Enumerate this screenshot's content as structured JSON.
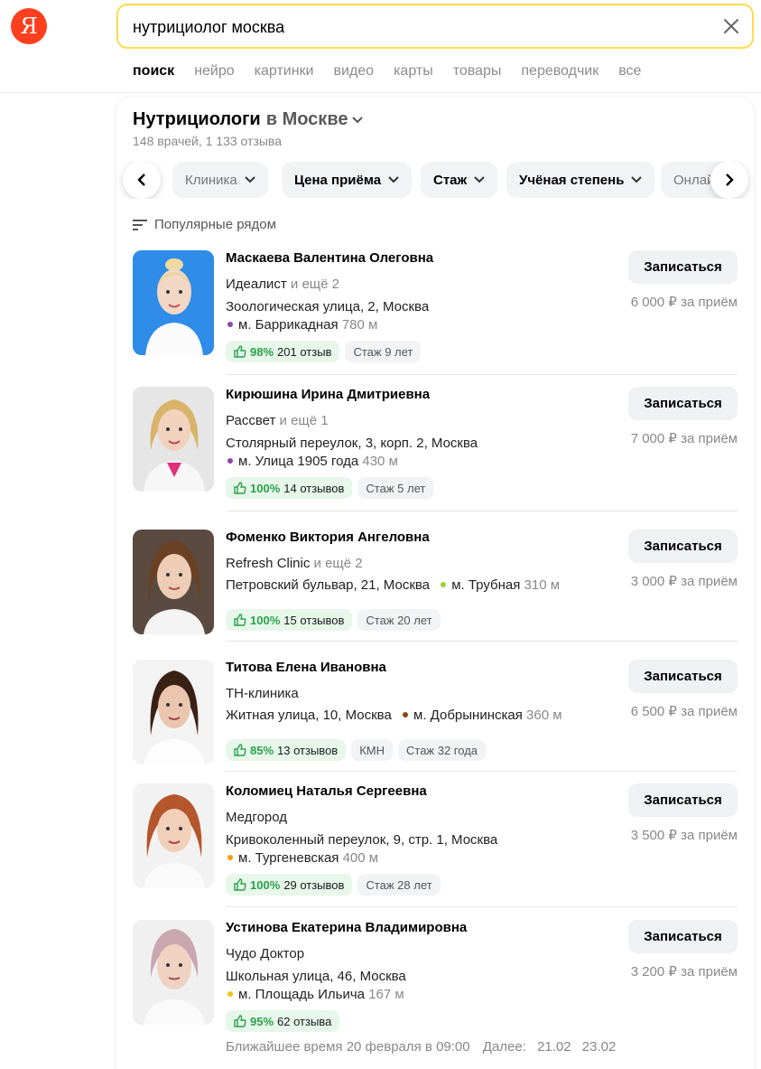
{
  "logo": "Я",
  "search": {
    "value": "нутрициолог москва"
  },
  "tabs": [
    "поиск",
    "нейро",
    "картинки",
    "видео",
    "карты",
    "товары",
    "переводчик",
    "все"
  ],
  "card": {
    "title_main": "Нутрициологи",
    "title_in": "в Москве",
    "subtitle": "148 врачей, 1 133 отзыва",
    "filters": [
      "Клиника",
      "Цена приёма",
      "Стаж",
      "Учёная степень",
      "Онлайн"
    ],
    "sort_label": "Популярные рядом",
    "book_label": "Записаться"
  },
  "doctors": [
    {
      "name": "Маскаева Валентина Олеговна",
      "clinic": "Идеалист",
      "clinic_more": "и ещё 2",
      "address": "Зоологическая улица, 2, Москва",
      "metro": "м. Баррикадная",
      "metro_dist": "780 м",
      "metro_color": "#8e44ad",
      "rating": "98%",
      "reviews": "201 отзыв",
      "tags": [
        "Стаж 9 лет"
      ],
      "price": "6 000 ₽ за приём"
    },
    {
      "name": "Кирюшина Ирина Дмитриевна",
      "clinic": "Рассвет",
      "clinic_more": "и ещё 1",
      "address": "Столярный переулок, 3, корп. 2, Москва",
      "metro": "м. Улица 1905 года",
      "metro_dist": "430 м",
      "metro_color": "#8e44ad",
      "rating": "100%",
      "reviews": "14 отзывов",
      "tags": [
        "Стаж 5 лет"
      ],
      "price": "7 000 ₽ за приём"
    },
    {
      "name": "Фоменко Виктория Ангеловна",
      "clinic": "Refresh Clinic",
      "clinic_more": "и ещё 2",
      "address": "Петровский бульвар, 21, Москва",
      "metro": "м. Трубная",
      "metro_dist": "310 м",
      "metro_color": "#9acd32",
      "rating": "100%",
      "reviews": "15 отзывов",
      "tags": [
        "Стаж 20 лет"
      ],
      "price": "3 000 ₽ за приём"
    },
    {
      "name": "Титова Елена Ивановна",
      "clinic": "ТН-клиника",
      "clinic_more": "",
      "address": "Житная улица, 10, Москва",
      "metro": "м. Добрынинская",
      "metro_dist": "360 м",
      "metro_color": "#8b4513",
      "rating": "85%",
      "reviews": "13 отзывов",
      "tags": [
        "КМН",
        "Стаж 32 года"
      ],
      "price": "6 500 ₽ за приём"
    },
    {
      "name": "Коломиец Наталья Сергеевна",
      "clinic": "Медгород",
      "clinic_more": "",
      "address": "Кривоколенный переулок, 9, стр. 1, Москва",
      "metro": "м. Тургеневская",
      "metro_dist": "400 м",
      "metro_color": "#f39c12",
      "rating": "100%",
      "reviews": "29 отзывов",
      "tags": [
        "Стаж 28 лет"
      ],
      "price": "3 500 ₽ за приём"
    },
    {
      "name": "Устинова Екатерина Владимировна",
      "clinic": "Чудо Доктор",
      "clinic_more": "",
      "address": "Школьная улица, 46, Москва",
      "metro": "м. Площадь Ильича",
      "metro_dist": "167 м",
      "metro_color": "#f1c40f",
      "rating": "95%",
      "reviews": "62 отзыва",
      "tags": [],
      "price": "3 200 ₽ за приём",
      "slots": {
        "nearest": "Ближайшее время 20 февраля в 09:00",
        "next_label": "Далее:",
        "dates": [
          "21.02",
          "23.02"
        ]
      }
    }
  ]
}
